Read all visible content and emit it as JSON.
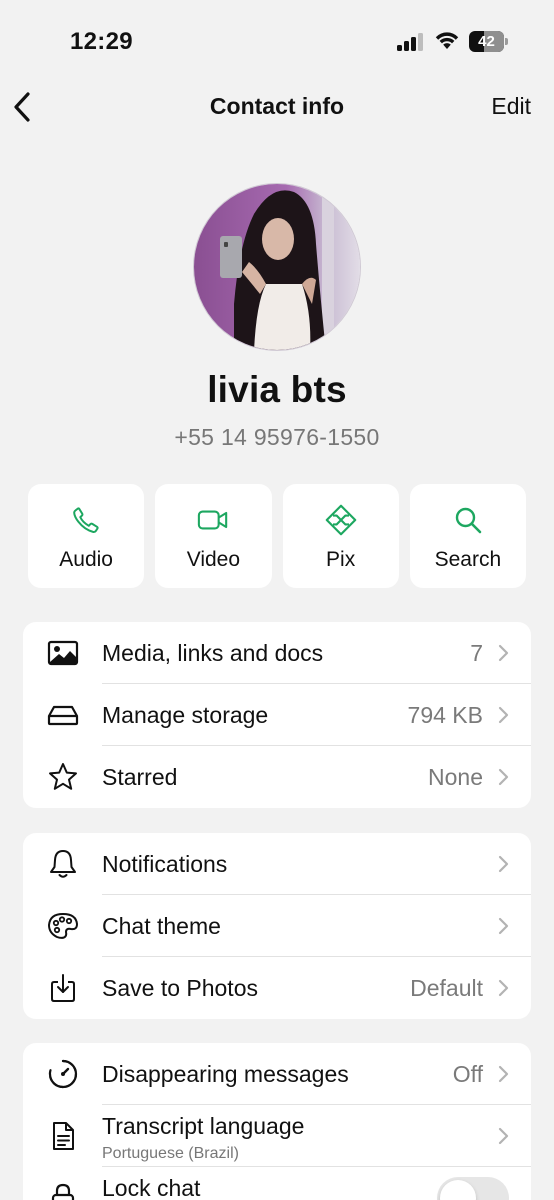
{
  "status_bar": {
    "time": "12:29",
    "battery_level": "42",
    "battery_fraction": 0.42,
    "signal_bars_active": 3,
    "signal_bars_total": 4
  },
  "nav": {
    "title": "Contact info",
    "edit_label": "Edit",
    "back_icon": "chevron-left-icon"
  },
  "contact": {
    "name": "livia bts",
    "phone": "+55 14 95976-1550"
  },
  "actions": [
    {
      "label": "Audio",
      "icon": "phone-icon"
    },
    {
      "label": "Video",
      "icon": "video-icon"
    },
    {
      "label": "Pix",
      "icon": "pix-icon"
    },
    {
      "label": "Search",
      "icon": "search-icon"
    }
  ],
  "group1": [
    {
      "label": "Media, links and docs",
      "value": "7",
      "icon": "media-icon"
    },
    {
      "label": "Manage storage",
      "value": "794 KB",
      "icon": "storage-icon"
    },
    {
      "label": "Starred",
      "value": "None",
      "icon": "star-icon"
    }
  ],
  "group2": [
    {
      "label": "Notifications",
      "value": "",
      "icon": "bell-icon"
    },
    {
      "label": "Chat theme",
      "value": "",
      "icon": "palette-icon"
    },
    {
      "label": "Save to Photos",
      "value": "Default",
      "icon": "save-icon"
    }
  ],
  "group3": [
    {
      "label": "Disappearing messages",
      "value": "Off",
      "icon": "timer-icon"
    },
    {
      "label": "Transcript language",
      "sublabel": "Portuguese (Brazil)",
      "icon": "document-icon"
    },
    {
      "label": "Lock chat",
      "toggle_on": false,
      "icon": "lock-icon"
    }
  ],
  "colors": {
    "accent_green": "#1da760",
    "background": "#f2f2f2",
    "card": "#ffffff",
    "secondary_text": "#7a7a7a"
  }
}
